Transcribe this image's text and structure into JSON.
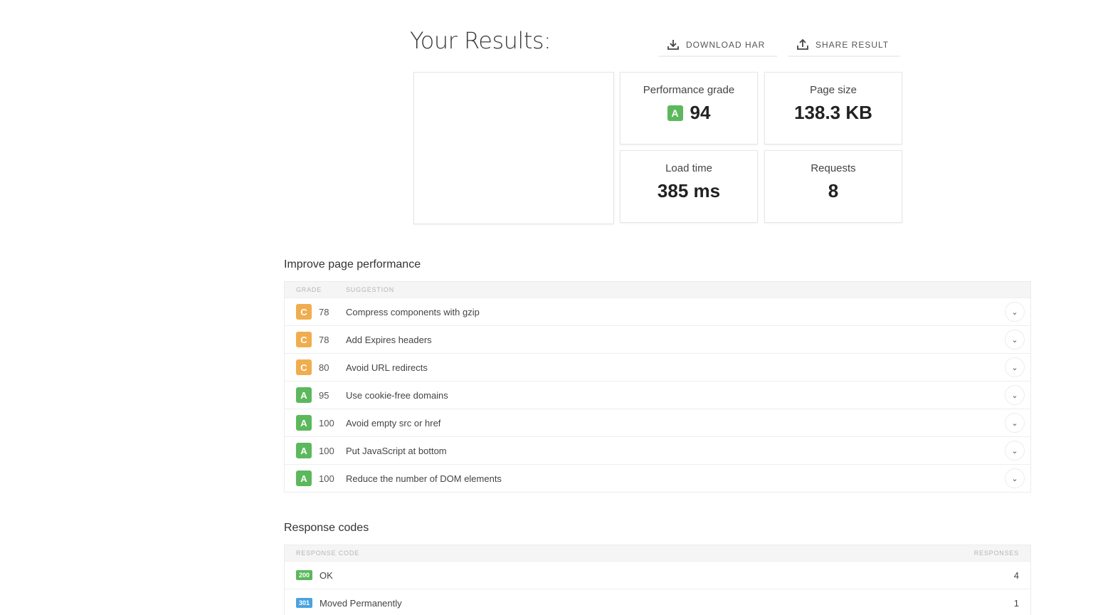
{
  "header": {
    "title": "Your Results:",
    "download_label": "DOWNLOAD HAR",
    "share_label": "SHARE RESULT"
  },
  "stats": {
    "performance": {
      "label": "Performance grade",
      "grade": "A",
      "value": "94"
    },
    "page_size": {
      "label": "Page size",
      "value": "138.3 KB"
    },
    "load_time": {
      "label": "Load time",
      "value": "385 ms"
    },
    "requests": {
      "label": "Requests",
      "value": "8"
    }
  },
  "improve": {
    "title": "Improve page performance",
    "col_grade": "GRADE",
    "col_suggestion": "SUGGESTION",
    "rows": [
      {
        "grade": "C",
        "score": "78",
        "suggestion": "Compress components with gzip"
      },
      {
        "grade": "C",
        "score": "78",
        "suggestion": "Add Expires headers"
      },
      {
        "grade": "C",
        "score": "80",
        "suggestion": "Avoid URL redirects"
      },
      {
        "grade": "A",
        "score": "95",
        "suggestion": "Use cookie-free domains"
      },
      {
        "grade": "A",
        "score": "100",
        "suggestion": "Avoid empty src or href"
      },
      {
        "grade": "A",
        "score": "100",
        "suggestion": "Put JavaScript at bottom"
      },
      {
        "grade": "A",
        "score": "100",
        "suggestion": "Reduce the number of DOM elements"
      }
    ]
  },
  "codes": {
    "title": "Response codes",
    "col_code": "RESPONSE CODE",
    "col_responses": "RESPONSES",
    "rows": [
      {
        "code": "200",
        "text": "OK",
        "count": "4"
      },
      {
        "code": "301",
        "text": "Moved Permanently",
        "count": "1"
      }
    ]
  },
  "colors": {
    "grade_a": "#5cb85c",
    "grade_c": "#f0ad4e",
    "code_200": "#5cb85c",
    "code_301": "#4aa3df"
  }
}
